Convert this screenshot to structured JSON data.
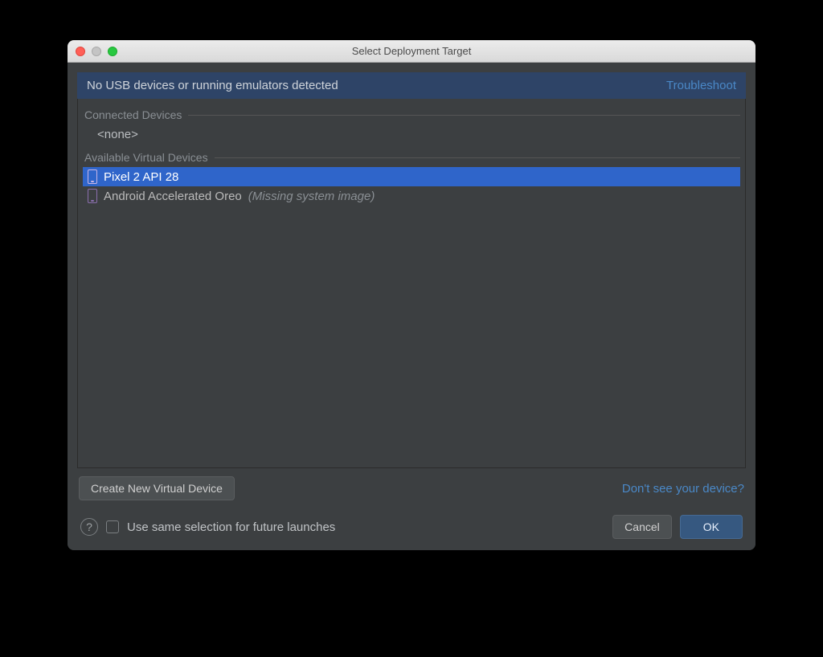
{
  "window": {
    "title": "Select Deployment Target"
  },
  "banner": {
    "message": "No USB devices or running emulators detected",
    "troubleshoot": "Troubleshoot"
  },
  "sections": {
    "connected": {
      "header": "Connected Devices",
      "none": "<none>"
    },
    "available": {
      "header": "Available Virtual Devices",
      "devices": [
        {
          "name": "Pixel 2 API 28",
          "note": "",
          "selected": true
        },
        {
          "name": "Android Accelerated Oreo",
          "note": "(Missing system image)",
          "selected": false
        }
      ]
    }
  },
  "actions": {
    "create_new": "Create New Virtual Device",
    "dont_see": "Don't see your device?",
    "use_same": "Use same selection for future launches",
    "cancel": "Cancel",
    "ok": "OK"
  }
}
